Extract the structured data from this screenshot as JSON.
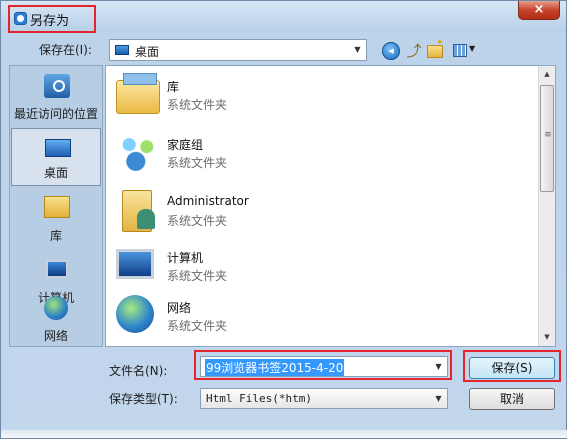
{
  "window": {
    "title": "另存为",
    "close_glyph": "×"
  },
  "toolbar": {
    "save_in_label": "保存在(I):",
    "location": "桌面",
    "back_icon": "back-arrow-icon",
    "up_icon": "up-folder-icon",
    "new_folder_icon": "new-folder-icon",
    "view_icon": "view-menu-icon"
  },
  "places": [
    {
      "label": "最近访问的位置",
      "icon": "recent-places-icon"
    },
    {
      "label": "桌面",
      "icon": "desktop-icon",
      "selected": true
    },
    {
      "label": "库",
      "icon": "libraries-icon"
    },
    {
      "label": "计算机",
      "icon": "computer-icon"
    },
    {
      "label": "网络",
      "icon": "network-icon"
    }
  ],
  "files": [
    {
      "name": "库",
      "type": "系统文件夹",
      "icon": "library-folder-icon"
    },
    {
      "name": "家庭组",
      "type": "系统文件夹",
      "icon": "homegroup-icon"
    },
    {
      "name": "Administrator",
      "type": "系统文件夹",
      "icon": "user-folder-icon"
    },
    {
      "name": "计算机",
      "type": "系统文件夹",
      "icon": "computer-icon"
    },
    {
      "name": "网络",
      "type": "系统文件夹",
      "icon": "network-icon"
    }
  ],
  "form": {
    "filename_label": "文件名(N):",
    "filename_value": "99浏览器书签2015-4-20",
    "filetype_label": "保存类型(T):",
    "filetype_value": "Html Files(*htm)"
  },
  "buttons": {
    "save": "保存(S)",
    "cancel": "取消"
  },
  "colors": {
    "highlight_box": "#e2262b",
    "selection": "#3399ff"
  }
}
